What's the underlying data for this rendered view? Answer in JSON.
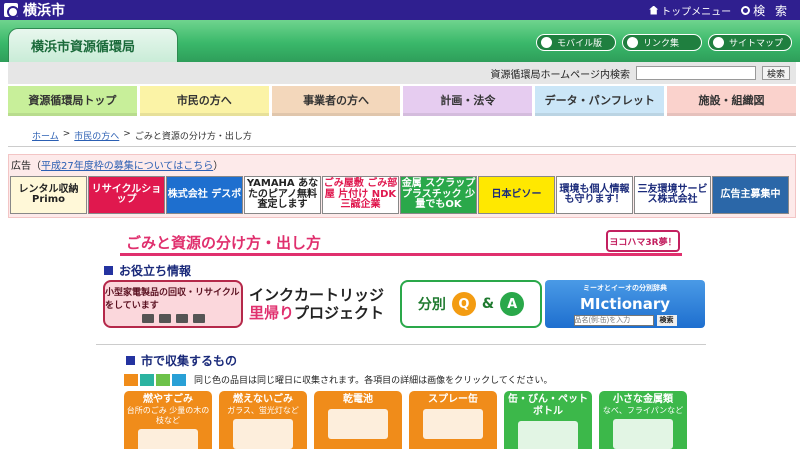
{
  "header": {
    "logo_text": "横浜市",
    "top_menu_label": "トップメニュー",
    "search_label": "検 索"
  },
  "banner": {
    "title": "横浜市資源循環局",
    "buttons": [
      {
        "label": "モバイル版",
        "icon": "pen-icon"
      },
      {
        "label": "リンク集",
        "icon": "link-icon"
      },
      {
        "label": "サイトマップ",
        "icon": "sitemap-icon"
      }
    ]
  },
  "site_search": {
    "label": "資源循環局ホームページ内検索",
    "button": "検索",
    "value": ""
  },
  "categories": [
    {
      "label": "資源循環局トップ",
      "color": "#c8ef9a"
    },
    {
      "label": "市民の方へ",
      "color": "#fbf3a6"
    },
    {
      "label": "事業者の方へ",
      "color": "#f3d7bb"
    },
    {
      "label": "計画・法令",
      "color": "#e6ccf0"
    },
    {
      "label": "データ・パンフレット",
      "color": "#cbe6f7"
    },
    {
      "label": "施設・組織図",
      "color": "#fad2cc"
    }
  ],
  "breadcrumb": {
    "home": "ホーム",
    "sep": ">",
    "citizens": "市民の方へ",
    "current": "ごみと資源の分け方・出し方"
  },
  "ad": {
    "label": "広告",
    "link_text": "平成27年度枠の募集についてはこちら",
    "paren_open": "（",
    "paren_close": "）",
    "banners": [
      {
        "text": "レンタル収納 Primo",
        "bg": "#fff8d8",
        "fg": "#222"
      },
      {
        "text": "リサイクルショップ",
        "bg": "#e0184e",
        "fg": "#ffffff"
      },
      {
        "text": "株式会社 デスポ",
        "bg": "#1e6fcf",
        "fg": "#ffffff"
      },
      {
        "text": "YAMAHA あなたのピアノ無料査定します",
        "bg": "#ffffff",
        "fg": "#222"
      },
      {
        "text": "ごみ屋敷 ごみ部屋 片付け NDK 三誠企業",
        "bg": "#ffffff",
        "fg": "#e0184e"
      },
      {
        "text": "金属 スクラップ プラスチック 少量でもOK",
        "bg": "#2aa84a",
        "fg": "#ffffff"
      },
      {
        "text": "日本ビソー",
        "bg": "#ffe800",
        "fg": "#1a2a7a"
      },
      {
        "text": "環境も個人情報も守ります！",
        "bg": "#ffffff",
        "fg": "#1a2a7a"
      },
      {
        "text": "三友環境サービス株式会社",
        "bg": "#ffffff",
        "fg": "#1a2a7a"
      },
      {
        "text": "広告主募集中",
        "bg": "#2b67a8",
        "fg": "#ffffff"
      }
    ]
  },
  "main": {
    "title": "ごみと資源の分け方・出し方",
    "badge": "ヨコハマ3R夢！",
    "useful_heading": "お役立ち情報",
    "info": {
      "small_appliance": "小型家電製品の回収・リサイクルをしています",
      "ink_line1": "インクカートリッジ",
      "ink_line2_a": "里帰り",
      "ink_line2_b": "プロジェクト",
      "qa_label": "分別",
      "qa_q": "Q",
      "qa_amp": "&",
      "qa_a": "A",
      "dict_small": "ミーオとイーオの分別辞典",
      "dict_title": "MIctionary",
      "dict_placeholder": "品名(例:缶)を入力",
      "dict_button": "検索"
    },
    "collect_heading": "市で収集するもの",
    "color_note": "同じ色の品目は同じ曜日に収集されます。各項目の詳細は画像をクリックしてください。",
    "color_keys": [
      "#f08c1a",
      "#2bb3a0",
      "#6dc24a",
      "#29a0d6"
    ],
    "bins": [
      {
        "name": "燃やすごみ",
        "sub": "台所のごみ 少量の木の枝など",
        "color": "#f08c1a"
      },
      {
        "name": "燃えないごみ",
        "sub": "ガラス、蛍光灯など",
        "color": "#f08c1a"
      },
      {
        "name": "乾電池",
        "sub": "",
        "color": "#f08c1a"
      },
      {
        "name": "スプレー缶",
        "sub": "",
        "color": "#f08c1a"
      },
      {
        "name": "缶・びん・ペットボトル",
        "sub": "",
        "color": "#3cb84a"
      },
      {
        "name": "小さな金属類",
        "sub": "なべ、フライパンなど",
        "color": "#3cb84a"
      }
    ]
  }
}
